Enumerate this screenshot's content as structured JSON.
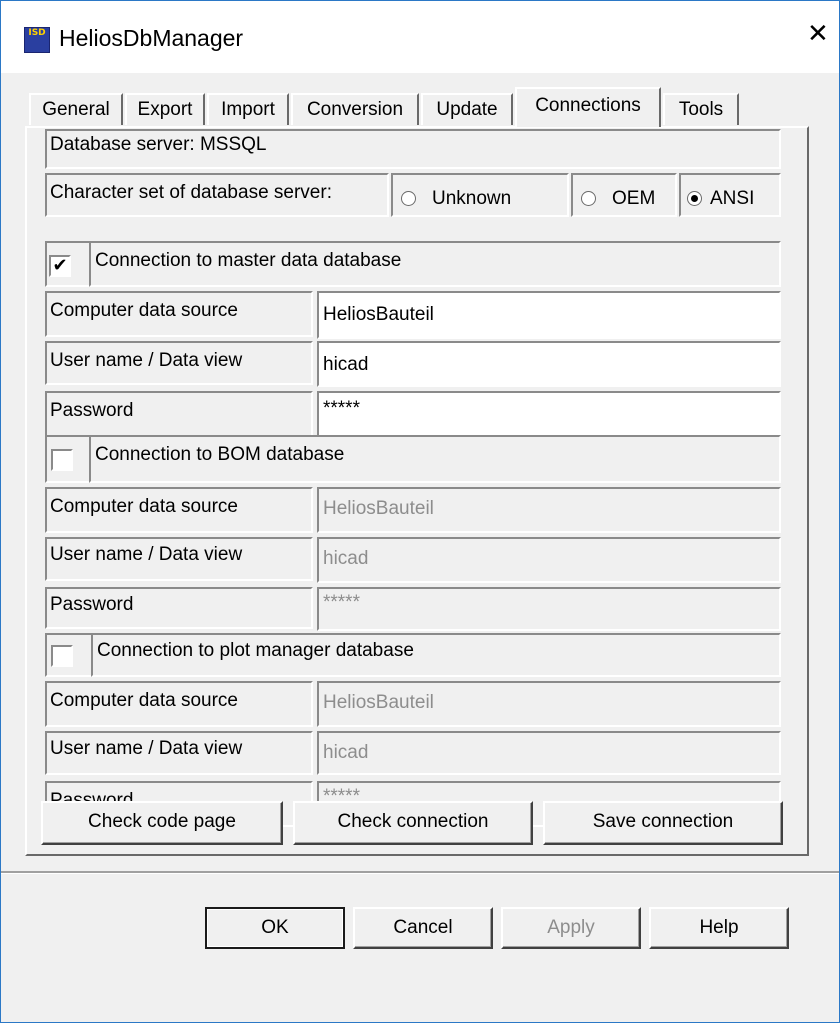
{
  "window": {
    "title": "HeliosDbManager",
    "app_icon_text": "ISD",
    "close_symbol": "✕"
  },
  "tabs": [
    "General",
    "Export",
    "Import",
    "Conversion",
    "Update",
    "Connections",
    "Tools"
  ],
  "active_tab": "Connections",
  "server": {
    "label": "Database server: MSSQL",
    "charset_label": "Character set of database server:",
    "charset_options": [
      "Unknown",
      "OEM",
      "ANSI"
    ],
    "charset_selected": "ANSI"
  },
  "sections": [
    {
      "title": "Connection to master data database",
      "checked": true,
      "check_mark": "✔",
      "rows": [
        {
          "label": "Computer data source",
          "value": "HeliosBauteil"
        },
        {
          "label": "User name / Data view",
          "value": "hicad"
        },
        {
          "label": "Password",
          "value": "*****"
        }
      ]
    },
    {
      "title": "Connection to BOM database",
      "checked": false,
      "check_mark": "",
      "rows": [
        {
          "label": "Computer data source",
          "value": "HeliosBauteil"
        },
        {
          "label": "User name / Data view",
          "value": "hicad"
        },
        {
          "label": "Password",
          "value": "*****"
        }
      ]
    },
    {
      "title": "Connection to plot manager database",
      "checked": false,
      "check_mark": "",
      "rows": [
        {
          "label": "Computer data source",
          "value": "HeliosBauteil"
        },
        {
          "label": "User name / Data view",
          "value": "hicad"
        },
        {
          "label": "Password",
          "value": "*****"
        }
      ]
    }
  ],
  "actions": {
    "check_code_page": "Check code page",
    "check_connection": "Check connection",
    "save_connection": "Save connection"
  },
  "footer": {
    "ok": "OK",
    "cancel": "Cancel",
    "apply": "Apply",
    "help": "Help"
  }
}
